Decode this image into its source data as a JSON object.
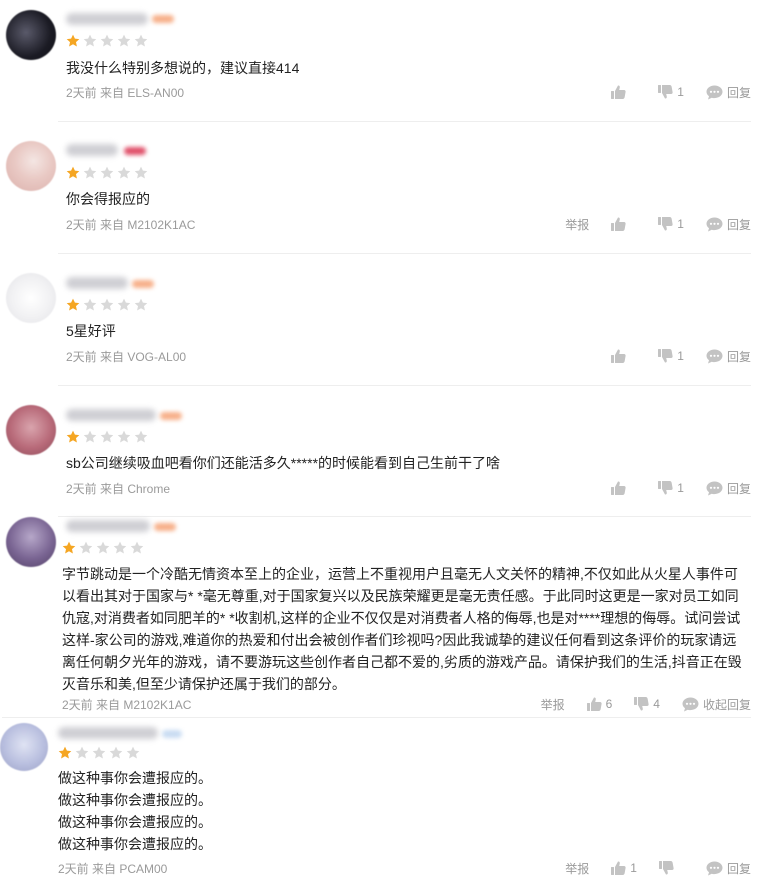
{
  "colors": {
    "star_on": "#f5a623",
    "star_off": "#d9d9d9",
    "icon": "#c3c3c3",
    "meta": "#9a9a9a"
  },
  "icons": {
    "like": "thumbs-up-icon",
    "dislike": "thumbs-down-icon",
    "reply": "reply-bubble-icon",
    "star": "star-icon"
  },
  "comments": [
    {
      "rating": 1,
      "text": "我没什么特别多想说的，建议直接414",
      "meta": "2天前 来自 ELS-AN00",
      "report": "",
      "likes": "",
      "dislikes": "1",
      "reply": "回复"
    },
    {
      "rating": 1,
      "text": "你会得报应的",
      "meta": "2天前 来自 M2102K1AC",
      "report": "举报",
      "likes": "",
      "dislikes": "1",
      "reply": "回复"
    },
    {
      "rating": 1,
      "text": "5星好评",
      "meta": "2天前 来自 VOG-AL00",
      "report": "",
      "likes": "",
      "dislikes": "1",
      "reply": "回复"
    },
    {
      "rating": 1,
      "text": "sb公司继续吸血吧看你们还能活多久*****的时候能看到自己生前干了啥",
      "meta": "2天前 来自 Chrome",
      "report": "",
      "likes": "",
      "dislikes": "1",
      "reply": "回复"
    },
    {
      "rating": 1,
      "text": "字节跳动是一个冷酷无情资本至上的企业，运营上不重视用户且毫无人文关怀的精神,不仅如此从火星人事件可以看出其对于国家与* *毫无尊重,对于国家复兴以及民族荣耀更是毫无责任感。于此同时这更是一家对员工如同仇寇,对消费者如同肥羊的* *收割机,这样的企业不仅仅是对消费者人格的侮辱,也是对****理想的侮辱。试问尝试这样-家公司的游戏,难道你的热爱和付出会被创作者们珍视吗?因此我诚挚的建议任何看到这条评价的玩家请远离任何朝夕光年的游戏，请不要游玩这些创作者自己都不爱的,劣质的游戏产品。请保护我们的生活,抖音正在毁灭音乐和美,但至少请保护还属于我们的部分。",
      "meta": "2天前 来自 M2102K1AC",
      "report": "举报",
      "likes": "6",
      "dislikes": "4",
      "reply": "收起回复"
    },
    {
      "rating": 1,
      "text": "做这种事你会遭报应的。\n做这种事你会遭报应的。\n做这种事你会遭报应的。\n做这种事你会遭报应的。",
      "meta": "2天前 来自 PCAM00",
      "report": "举报",
      "likes": "1",
      "dislikes": "",
      "reply": "回复"
    }
  ]
}
